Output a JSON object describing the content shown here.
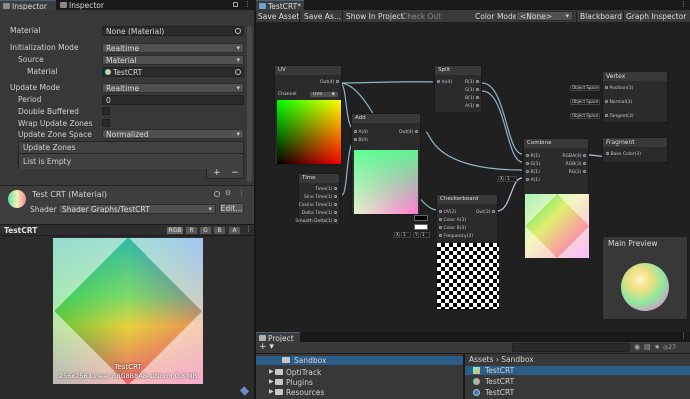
{
  "left_tabs": {
    "inspector1": "Inspector",
    "inspector2": "Inspector"
  },
  "inspector": {
    "rows": [
      {
        "label": "Material",
        "value": "None (Material)"
      },
      {
        "label": "Initialization Mode",
        "value": "Realtime"
      },
      {
        "label": "Source",
        "value": "Material"
      },
      {
        "label": "Material",
        "value": "TestCRT"
      },
      {
        "label": "Update Mode",
        "value": "Realtime"
      },
      {
        "label": "Period",
        "value": "0"
      },
      {
        "label": "Double Buffered",
        "value": ""
      },
      {
        "label": "Wrap Update Zones",
        "value": ""
      },
      {
        "label": "Update Zone Space",
        "value": "Normalized"
      }
    ],
    "update_zones_header": "Update Zones",
    "list_empty": "List is Empty",
    "add_symbol": "+",
    "remove_symbol": "−",
    "material_title": "Test CRT (Material)",
    "shader_label": "Shader",
    "shader_value": "Shader Graphs/TestCRT",
    "edit_button": "Edit..."
  },
  "preview": {
    "title": "TestCRT",
    "channels": [
      "RGB",
      "R",
      "G",
      "B",
      "A"
    ],
    "caption_name": "TestCRT",
    "caption_info": "256x256  Linear  R8G8B8A8_UNorm  0.8 MB"
  },
  "graph": {
    "tab_title": "TestCRT*",
    "toolbar": {
      "save_asset": "Save Asset",
      "save_as": "Save As...",
      "show_in_project": "Show In Project",
      "check_out": "Check Out",
      "color_mode_label": "Color Mode",
      "color_mode_value": "<None>",
      "blackboard": "Blackboard",
      "graph_inspector": "Graph Inspector"
    },
    "nodes": {
      "uv": {
        "title": "UV",
        "out": "Out(4)",
        "channel_label": "Channel",
        "channel_value": "UV0"
      },
      "split": {
        "title": "Split",
        "in": "In(4)",
        "outs": [
          "R(1)",
          "G(1)",
          "B(1)",
          "A(1)"
        ]
      },
      "add": {
        "title": "Add",
        "ins": [
          "A(4)",
          "B(4)"
        ],
        "out": "Out(4)"
      },
      "time": {
        "title": "Time",
        "outs": [
          "Time(1)",
          "Sine Time(1)",
          "Cosine Time(1)",
          "Delta Time(1)",
          "Smooth Delta(1)"
        ]
      },
      "checkerboard": {
        "title": "Checkerboard",
        "ins": [
          "UV(2)",
          "Color A(3)",
          "Color B(3)",
          "Frequency(2)"
        ],
        "out": "Out(3)",
        "freq_x": "X",
        "freq_x_val": "1",
        "freq_y": "Y",
        "freq_y_val": "1"
      },
      "combine": {
        "title": "Combine",
        "ins": [
          "R(1)",
          "G(1)",
          "B(1)",
          "A(1)"
        ],
        "outs": [
          "RGBA(4)",
          "RGB(3)",
          "RG(2)"
        ],
        "x_label": "X",
        "x_val": "1"
      },
      "vertex": {
        "title": "Vertex",
        "ports": [
          {
            "space": "Object Space",
            "name": "Position(3)"
          },
          {
            "space": "Object Space",
            "name": "Normal(3)"
          },
          {
            "space": "Object Space",
            "name": "Tangent(3)"
          }
        ]
      },
      "fragment": {
        "title": "Fragment",
        "port": "Base Color(3)"
      }
    },
    "main_preview": "Main Preview"
  },
  "project": {
    "tab": "Project",
    "add": "+",
    "count": "27",
    "tree": [
      "Sandbox",
      "OptiTrack",
      "Plugins",
      "Resources"
    ],
    "breadcrumb": [
      "Assets",
      "Sandbox"
    ],
    "files": [
      "TestCRT",
      "TestCRT",
      "TestCRT"
    ]
  },
  "colors": {
    "accent": "#46607c",
    "panel": "#383838",
    "wire": "#8fb4c4"
  }
}
